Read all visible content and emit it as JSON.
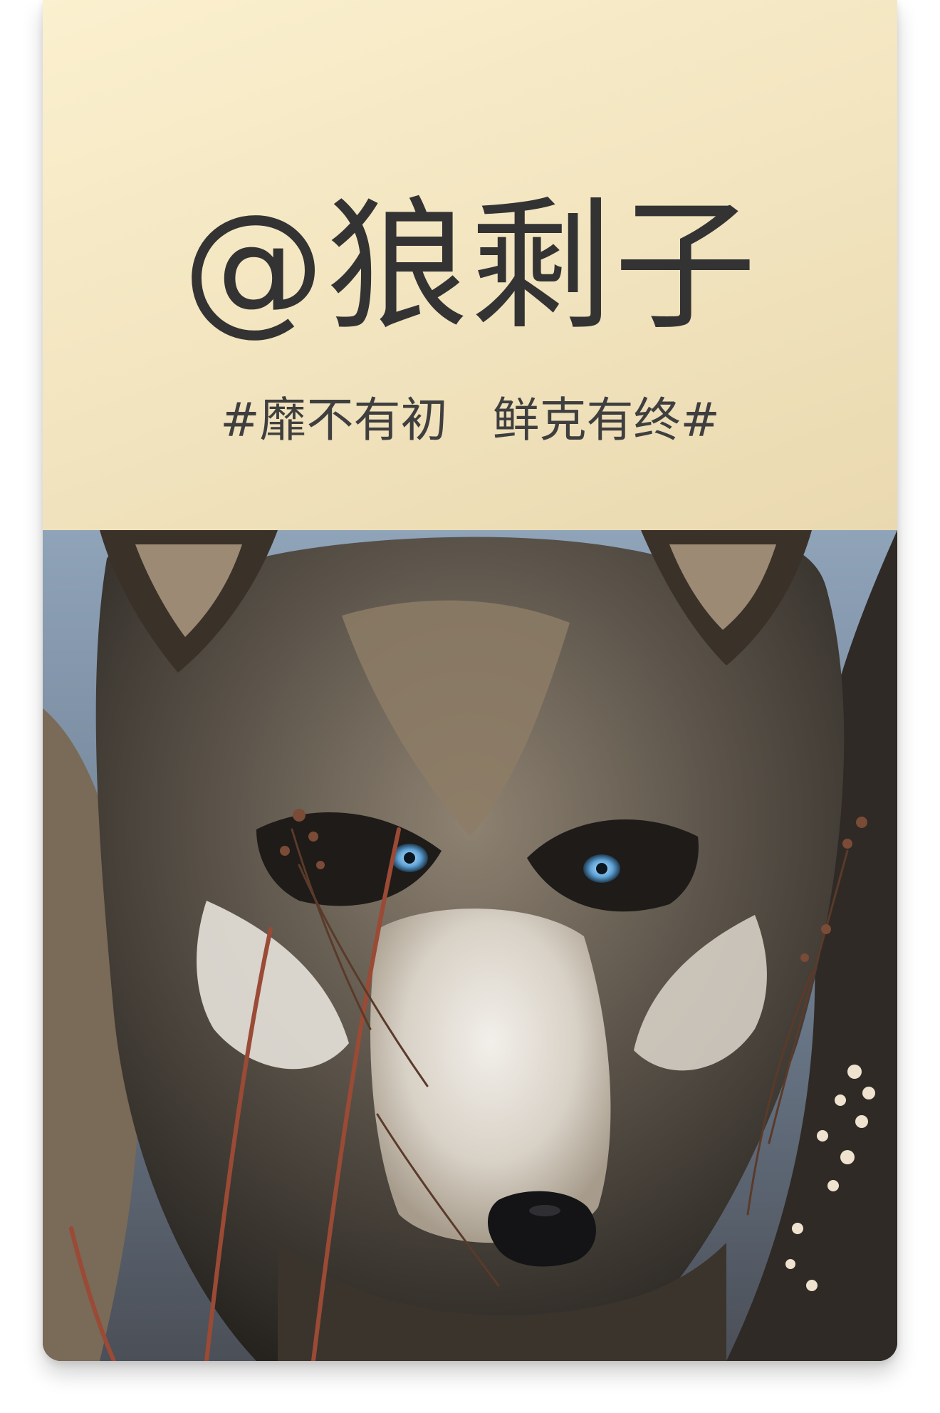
{
  "card": {
    "title": "@狼剩子",
    "subtitle": "#靡不有初   鲜克有终#",
    "header_gradient": [
      "#fbf0cf",
      "#ead9b0"
    ],
    "photo_icon": "wolf-portrait-photo"
  },
  "colors": {
    "text": "#333333",
    "header": "#f3e6c1"
  }
}
